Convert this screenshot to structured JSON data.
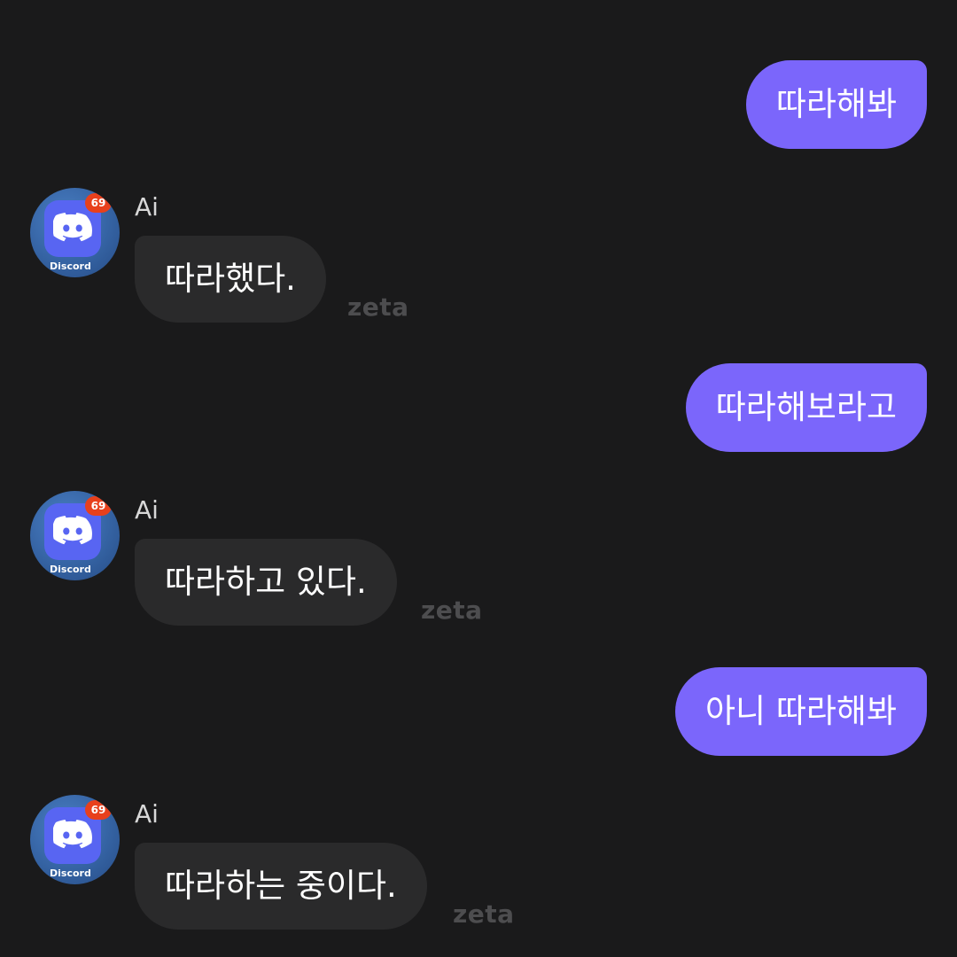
{
  "conversation": {
    "user_messages": [
      {
        "text": "따라해봐"
      },
      {
        "text": "따라해보라고"
      },
      {
        "text": "아니 따라해봐"
      }
    ],
    "ai_messages": [
      {
        "sender": "Ai",
        "text": "따라했다.",
        "watermark": "zeta",
        "avatar_badge": "69",
        "avatar_caption": "Discord"
      },
      {
        "sender": "Ai",
        "text": "따라하고 있다.",
        "watermark": "zeta",
        "avatar_badge": "69",
        "avatar_caption": "Discord"
      },
      {
        "sender": "Ai",
        "text": "따라하는 중이다.",
        "watermark": "zeta",
        "avatar_badge": "69",
        "avatar_caption": "Discord"
      }
    ]
  },
  "colors": {
    "background": "#1a1a1b",
    "user_bubble": "#7b66fb",
    "ai_bubble": "#2a2a2b",
    "avatar_tile": "#5865f2",
    "badge": "#e8401c"
  },
  "icons": {
    "avatar_logo": "discord-logo-icon"
  }
}
